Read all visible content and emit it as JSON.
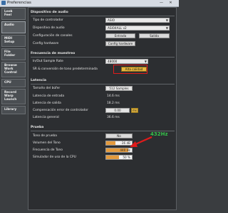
{
  "window": {
    "title": "Preferencias",
    "min_symbol": "—",
    "close_symbol": "✕"
  },
  "sidebar": {
    "items": [
      {
        "label": "Look\nFeel"
      },
      {
        "label": "Audio"
      },
      {
        "label": "MIDI\nSetup"
      },
      {
        "label": "File\nFolder"
      },
      {
        "label": "Browse\nWork\nControl"
      },
      {
        "label": "CPU"
      },
      {
        "label": "Record\nWarp\nLaunch"
      },
      {
        "label": "Library"
      }
    ]
  },
  "audio_device": {
    "section": "Dispositivo de audio",
    "driver_type_label": "Tipo de controlador",
    "driver_type_value": "ASIO",
    "device_label": "Dispositivo de audio",
    "device_value": "ASIO4ALL v2",
    "channel_config_label": "Configuración de canales",
    "input_button": "Entrada",
    "output_button": "Salida",
    "hardware_config_label": "Config hardware",
    "hardware_config_button": "Config hardware"
  },
  "sample_rate": {
    "section": "Frecuencia de muestreo",
    "in_out_label": "In/Out Sample Rate",
    "in_out_value": "48000",
    "sr_conversion_label": "SR & conversión de tono predeterminada",
    "sr_conversion_button": "Alta calidad"
  },
  "latency": {
    "section": "Latencia",
    "buffer_size_label": "Tamaño del búfer",
    "buffer_size_value": "512 Samples",
    "input_latency_label": "Latencia de entrada",
    "input_latency_value": "14.6 ms",
    "output_latency_label": "Latencia de salida",
    "output_latency_value": "18.2 ms",
    "driver_comp_label": "Compensación error de controlador",
    "driver_comp_value": "0.00",
    "driver_comp_unit": "ms",
    "overall_latency_label": "Latencia general",
    "overall_latency_value": "36.6 ms"
  },
  "test": {
    "section": "Prueba",
    "tone_label": "Tono de prueba",
    "tone_button": "No",
    "volume_label": "Volumen del Tono",
    "volume_value": "-36 dB",
    "volume_fill": 0.35,
    "freq_label": "Frecuencia de Tono",
    "freq_value": "440 Hz",
    "freq_fill": 0.85,
    "cpu_label": "Simulador de uso de la CPU",
    "cpu_value": "50 %",
    "cpu_fill": 0.5
  },
  "annotation": {
    "text": "432Hz",
    "color": "#36c24a"
  }
}
